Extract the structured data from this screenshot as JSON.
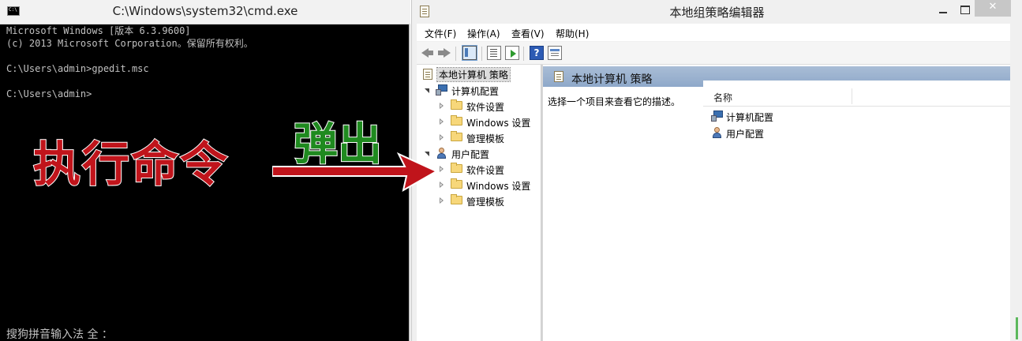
{
  "cmd": {
    "title": "C:\\Windows\\system32\\cmd.exe",
    "icon_text": "C:\\",
    "lines": [
      "Microsoft Windows [版本 6.3.9600]",
      "(c) 2013 Microsoft Corporation。保留所有权利。",
      "",
      "C:\\Users\\admin>gpedit.msc",
      "",
      "C:\\Users\\admin>"
    ],
    "ime_status": "搜狗拼音输入法 全 ："
  },
  "gpedit": {
    "title": "本地组策略编辑器",
    "close_glyph": "✕",
    "menu": [
      "文件(F)",
      "操作(A)",
      "查看(V)",
      "帮助(H)"
    ],
    "help_glyph": "?",
    "tree": {
      "root": "本地计算机 策略",
      "computer": "计算机配置",
      "computer_children": [
        "软件设置",
        "Windows 设置",
        "管理模板"
      ],
      "user": "用户配置",
      "user_children": [
        "软件设置",
        "Windows 设置",
        "管理模板"
      ]
    },
    "content": {
      "header": "本地计算机 策略",
      "description": "选择一个项目来查看它的描述。",
      "column_name": "名称",
      "items": [
        "计算机配置",
        "用户配置"
      ]
    }
  },
  "overlay": {
    "exec_label": "执行命令",
    "popup_label": "弹出",
    "exec_color": "#c0141b",
    "popup_color": "#1f8a1f"
  }
}
